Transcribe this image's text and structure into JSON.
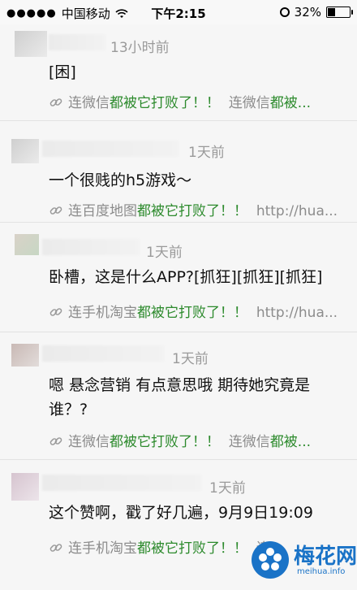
{
  "status_bar": {
    "carrier": "中国移动",
    "time": "下午2:15",
    "battery": "32%",
    "signal_dots": "●●●●●"
  },
  "comments": [
    {
      "time": "13小时前",
      "text": "[困]",
      "link_prefix": "连微信",
      "link_mid": "都被它打败了！！",
      "link_suffix": "连微信",
      "link_end": "都被..."
    },
    {
      "time": "1天前",
      "text": "一个很贱的h5游戏～",
      "link_prefix": "连百度地图",
      "link_mid": "都被它打败了！！",
      "link_suffix": "http://hua...",
      "link_end": ""
    },
    {
      "time": "1天前",
      "text": "卧槽，这是什么APP?[抓狂][抓狂][抓狂]",
      "link_prefix": "连手机淘宝",
      "link_mid": "都被它打败了！！",
      "link_suffix": "http://hua...",
      "link_end": ""
    },
    {
      "time": "1天前",
      "text": "嗯 悬念营销 有点意思哦 期待她究竟是谁？?",
      "link_prefix": "连微信",
      "link_mid": "都被它打败了！！",
      "link_suffix": "连微信",
      "link_end": "都被..."
    },
    {
      "time": "1天前",
      "text": "这个赞啊，戳了好几遍，9月9日19:09",
      "link_prefix": "连手机淘宝",
      "link_mid": "都被它打败了！！",
      "link_suffix": "连手机...",
      "link_end": ""
    }
  ],
  "watermark": {
    "cn": "梅花网",
    "en": "meihua.info"
  },
  "colors": {
    "link_highlight": "#2c8a2c",
    "meta_gray": "#9a9a9a",
    "brand_blue": "#1a73c7"
  }
}
